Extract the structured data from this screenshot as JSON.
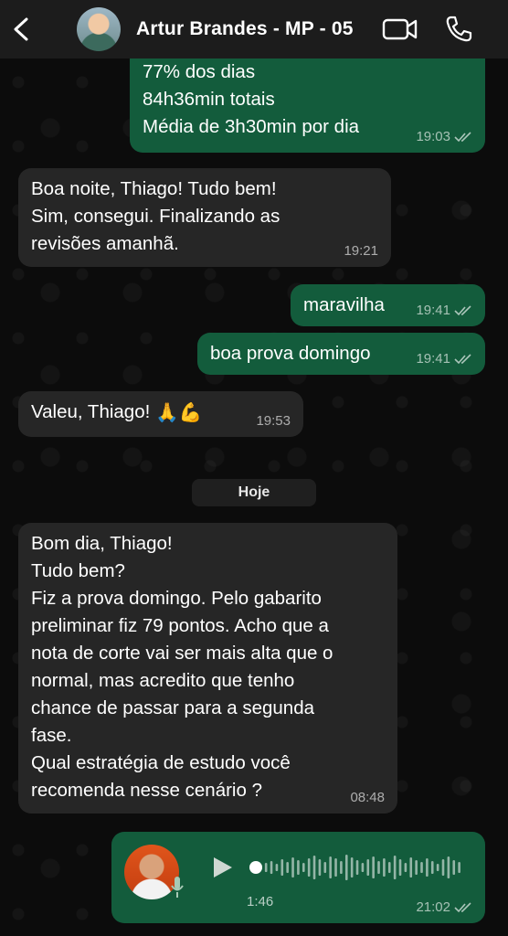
{
  "header": {
    "contact_name": "Artur Brandes - MP - 05",
    "back_icon": "chevron-left-icon",
    "video_icon": "video-call-icon",
    "phone_icon": "phone-call-icon"
  },
  "messages": [
    {
      "dir": "out",
      "text": "77% dos dias\n84h36min totais\nMédia de 3h30min por dia",
      "time": "19:03",
      "read": true
    },
    {
      "dir": "in",
      "text": "Boa noite, Thiago! Tudo bem!\nSim, consegui. Finalizando as\nrevisões amanhã.",
      "time": "19:21"
    },
    {
      "dir": "out",
      "text": "maravilha",
      "time": "19:41",
      "read": true
    },
    {
      "dir": "out",
      "text": "boa prova domingo",
      "time": "19:41",
      "read": true
    },
    {
      "dir": "in",
      "text": "Valeu, Thiago!",
      "emoji": "🙏💪",
      "time": "19:53"
    },
    {
      "dir": "in",
      "text": "Bom dia, Thiago!\nTudo bem?\nFiz a prova domingo. Pelo gabarito\npreliminar fiz 79 pontos. Acho que a\nnota de corte vai ser mais alta que o\nnormal, mas acredito que tenho\nchance de passar para a segunda\nfase.\nQual estratégia de estudo você\nrecomenda nesse cenário ?",
      "time": "08:48"
    }
  ],
  "day_separator": "Hoje",
  "voice_message": {
    "duration": "1:46",
    "time": "21:02",
    "read": true,
    "progress": 0.0
  },
  "colors": {
    "outgoing": "#135c3c",
    "incoming": "#262626",
    "header": "#1c1c1c"
  }
}
